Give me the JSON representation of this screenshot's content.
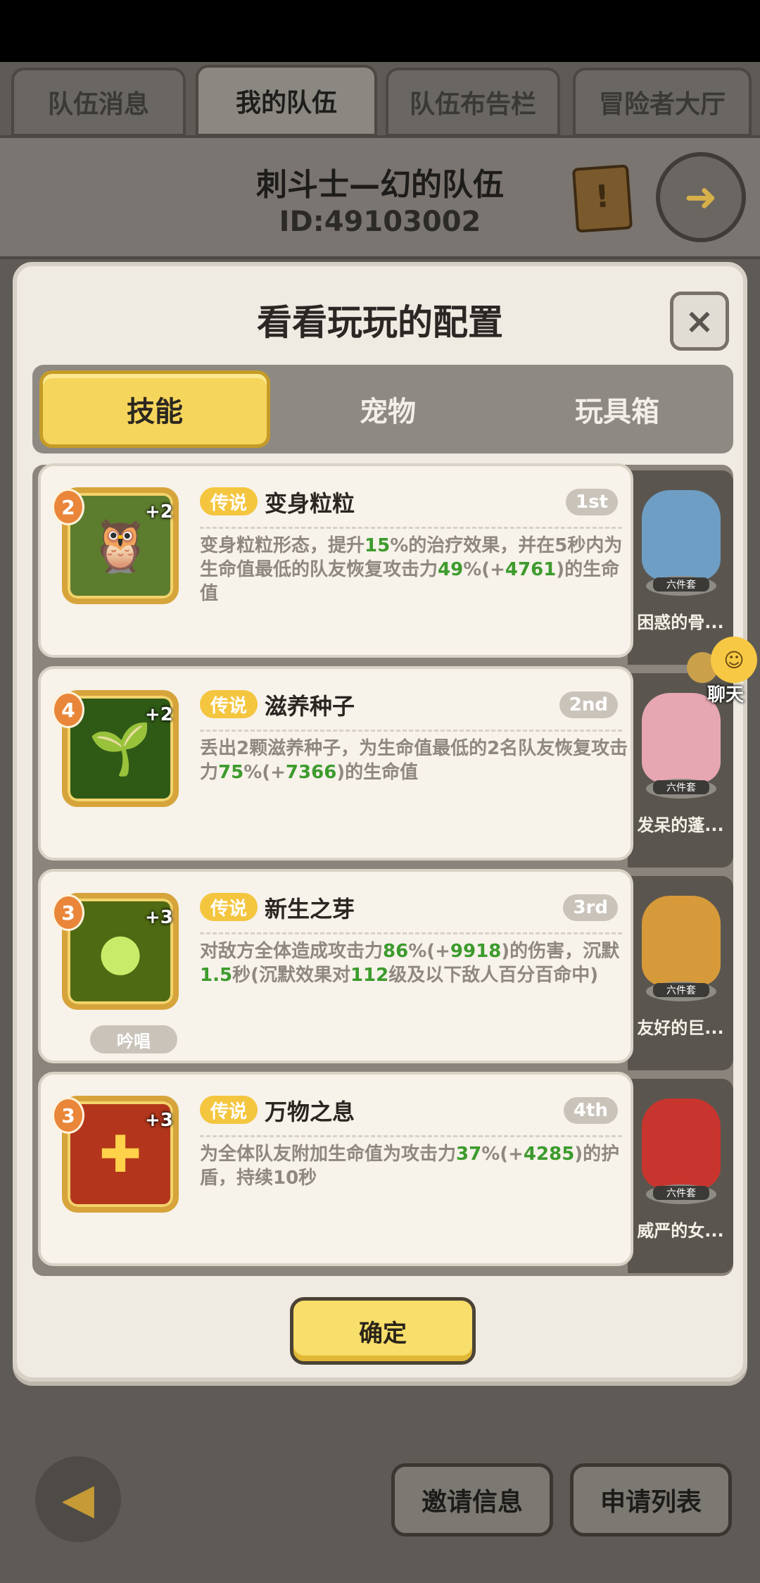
{
  "top_tabs": [
    {
      "label": "队伍消息"
    },
    {
      "label": "我的队伍"
    },
    {
      "label": "队伍布告栏"
    },
    {
      "label": "冒险者大厅"
    }
  ],
  "team": {
    "name": "刺斗士—幻的队伍",
    "id": "ID:49103002"
  },
  "modal": {
    "title": "看看玩玩的配置",
    "close": "×",
    "tabs": [
      "技能",
      "宠物",
      "玩具箱"
    ],
    "confirm": "确定"
  },
  "skills": [
    {
      "level": "2",
      "plus": "+2",
      "rarity": "传说",
      "name": "变身粒粒",
      "rank": "1st",
      "desc_parts": [
        "变身粒粒形态，提升",
        "15",
        "%的治疗效果，并在5秒内为生命值最低的队友恢复攻击力",
        "49",
        "%(+",
        "4761",
        ")的生命值"
      ],
      "pet_set": "六件套",
      "pet_name": "困惑的骨..."
    },
    {
      "level": "4",
      "plus": "+2",
      "rarity": "传说",
      "name": "滋养种子",
      "rank": "2nd",
      "desc_parts": [
        "丢出2颗滋养种子，为生命值最低的2名队友恢复攻击力",
        "75",
        "%(+",
        "7366",
        ")的生命值"
      ],
      "pet_set": "六件套",
      "pet_name": "发呆的蓬..."
    },
    {
      "level": "3",
      "plus": "+3",
      "rarity": "传说",
      "name": "新生之芽",
      "rank": "3rd",
      "desc_parts": [
        "对敌方全体造成攻击力",
        "86",
        "%(+",
        "9918",
        ")的伤害，沉默",
        "1.5",
        "秒(沉默效果对",
        "112",
        "级及以下敌人百分百命中)"
      ],
      "chant": "吟唱",
      "pet_set": "六件套",
      "pet_name": "友好的巨..."
    },
    {
      "level": "3",
      "plus": "+3",
      "rarity": "传说",
      "name": "万物之息",
      "rank": "4th",
      "desc_parts": [
        "为全体队友附加生命值为攻击力",
        "37",
        "%(+",
        "4285",
        ")的护盾，持续10秒"
      ],
      "pet_set": "六件套",
      "pet_name": "威严的女..."
    }
  ],
  "chat": {
    "label": "聊天"
  },
  "bottom": {
    "invite": "邀请信息",
    "apply": "申请列表"
  },
  "colors": {
    "accent_yellow": "#f6d55c",
    "green_value": "#3d9b2d",
    "rank_gray": "#c9c3ba"
  }
}
